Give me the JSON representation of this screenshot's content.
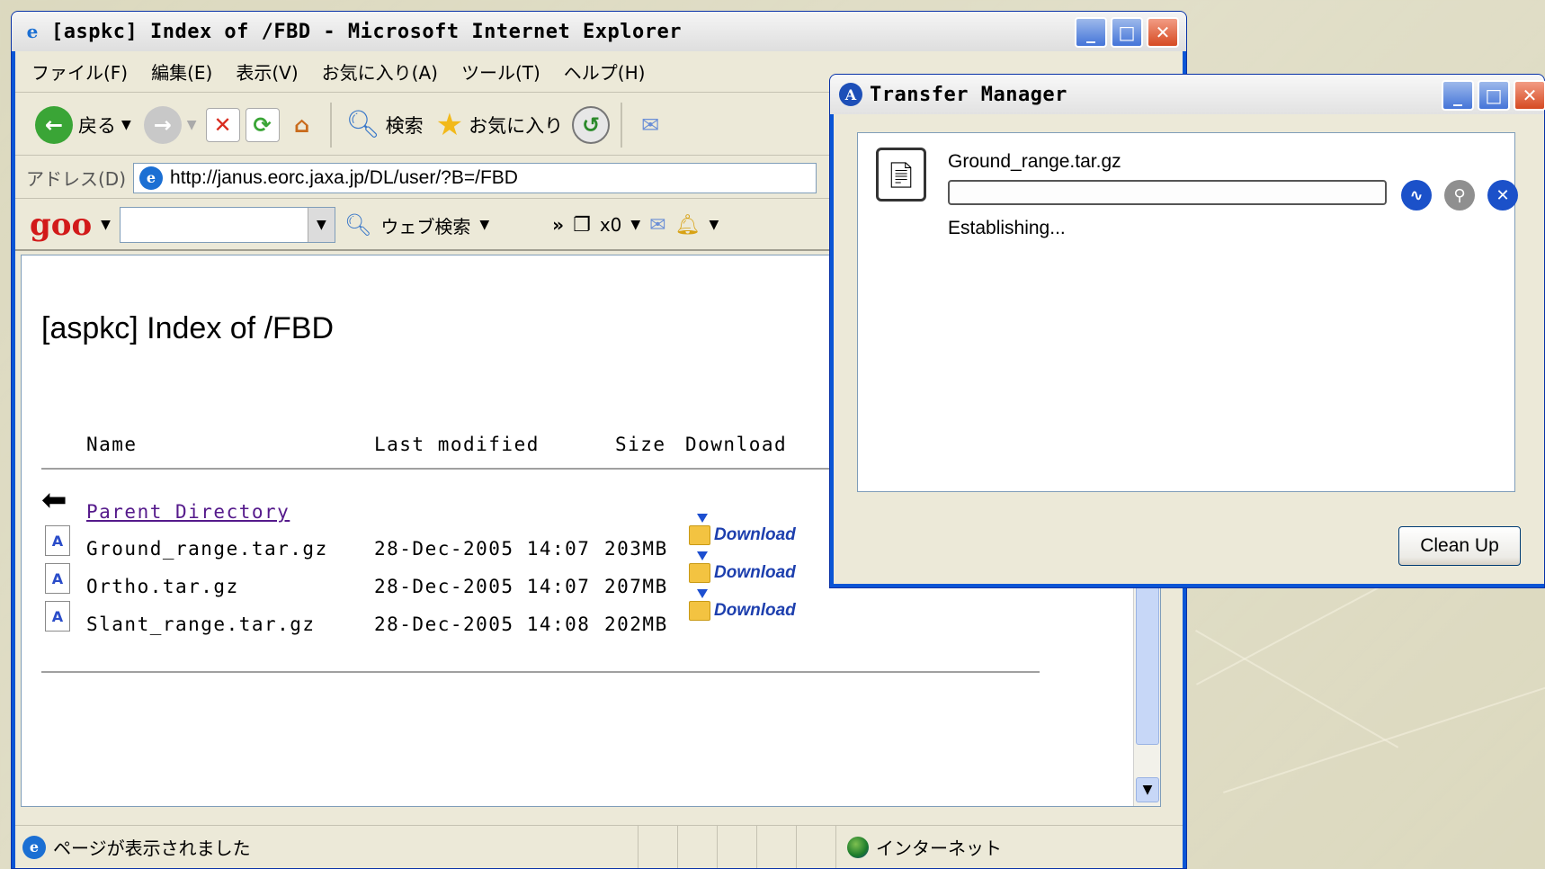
{
  "ie": {
    "title": "[aspkc] Index of /FBD - Microsoft Internet Explorer",
    "menu": [
      "ファイル(F)",
      "編集(E)",
      "表示(V)",
      "お気に入り(A)",
      "ツール(T)",
      "ヘルプ(H)"
    ],
    "toolbar": {
      "back": "戻る",
      "search": "検索",
      "favorites": "お気に入り"
    },
    "address": {
      "label": "アドレス(D)",
      "url": "http://janus.eorc.jaxa.jp/DL/user/?B=/FBD"
    },
    "goo": {
      "logo": "goo",
      "search_value": "",
      "web_search": "ウェブ検索",
      "more": "»",
      "count": "x0"
    },
    "page": {
      "title": "[aspkc] Index of /FBD",
      "headers": {
        "name": "Name",
        "modified": "Last modified",
        "size": "Size",
        "download": "Download"
      },
      "parent": "Parent Directory",
      "rows": [
        {
          "name": "Ground_range.tar.gz",
          "modified": "28-Dec-2005 14:07",
          "size": "203MB",
          "download": "Download"
        },
        {
          "name": "Ortho.tar.gz",
          "modified": "28-Dec-2005 14:07",
          "size": "207MB",
          "download": "Download"
        },
        {
          "name": "Slant_range.tar.gz",
          "modified": "28-Dec-2005 14:08",
          "size": "202MB",
          "download": "Download"
        }
      ]
    },
    "status": {
      "text": "ページが表示されました",
      "zone": "インターネット"
    }
  },
  "transfer_manager": {
    "title": "Transfer Manager",
    "file": "Ground_range.tar.gz",
    "progress": 0,
    "status": "Establishing...",
    "clean_up": "Clean Up"
  },
  "colors": {
    "xp_blue": "#0a55d5",
    "link_visited": "#551a8b",
    "goo_red": "#d21a1a",
    "download_blue": "#1d3fae"
  }
}
